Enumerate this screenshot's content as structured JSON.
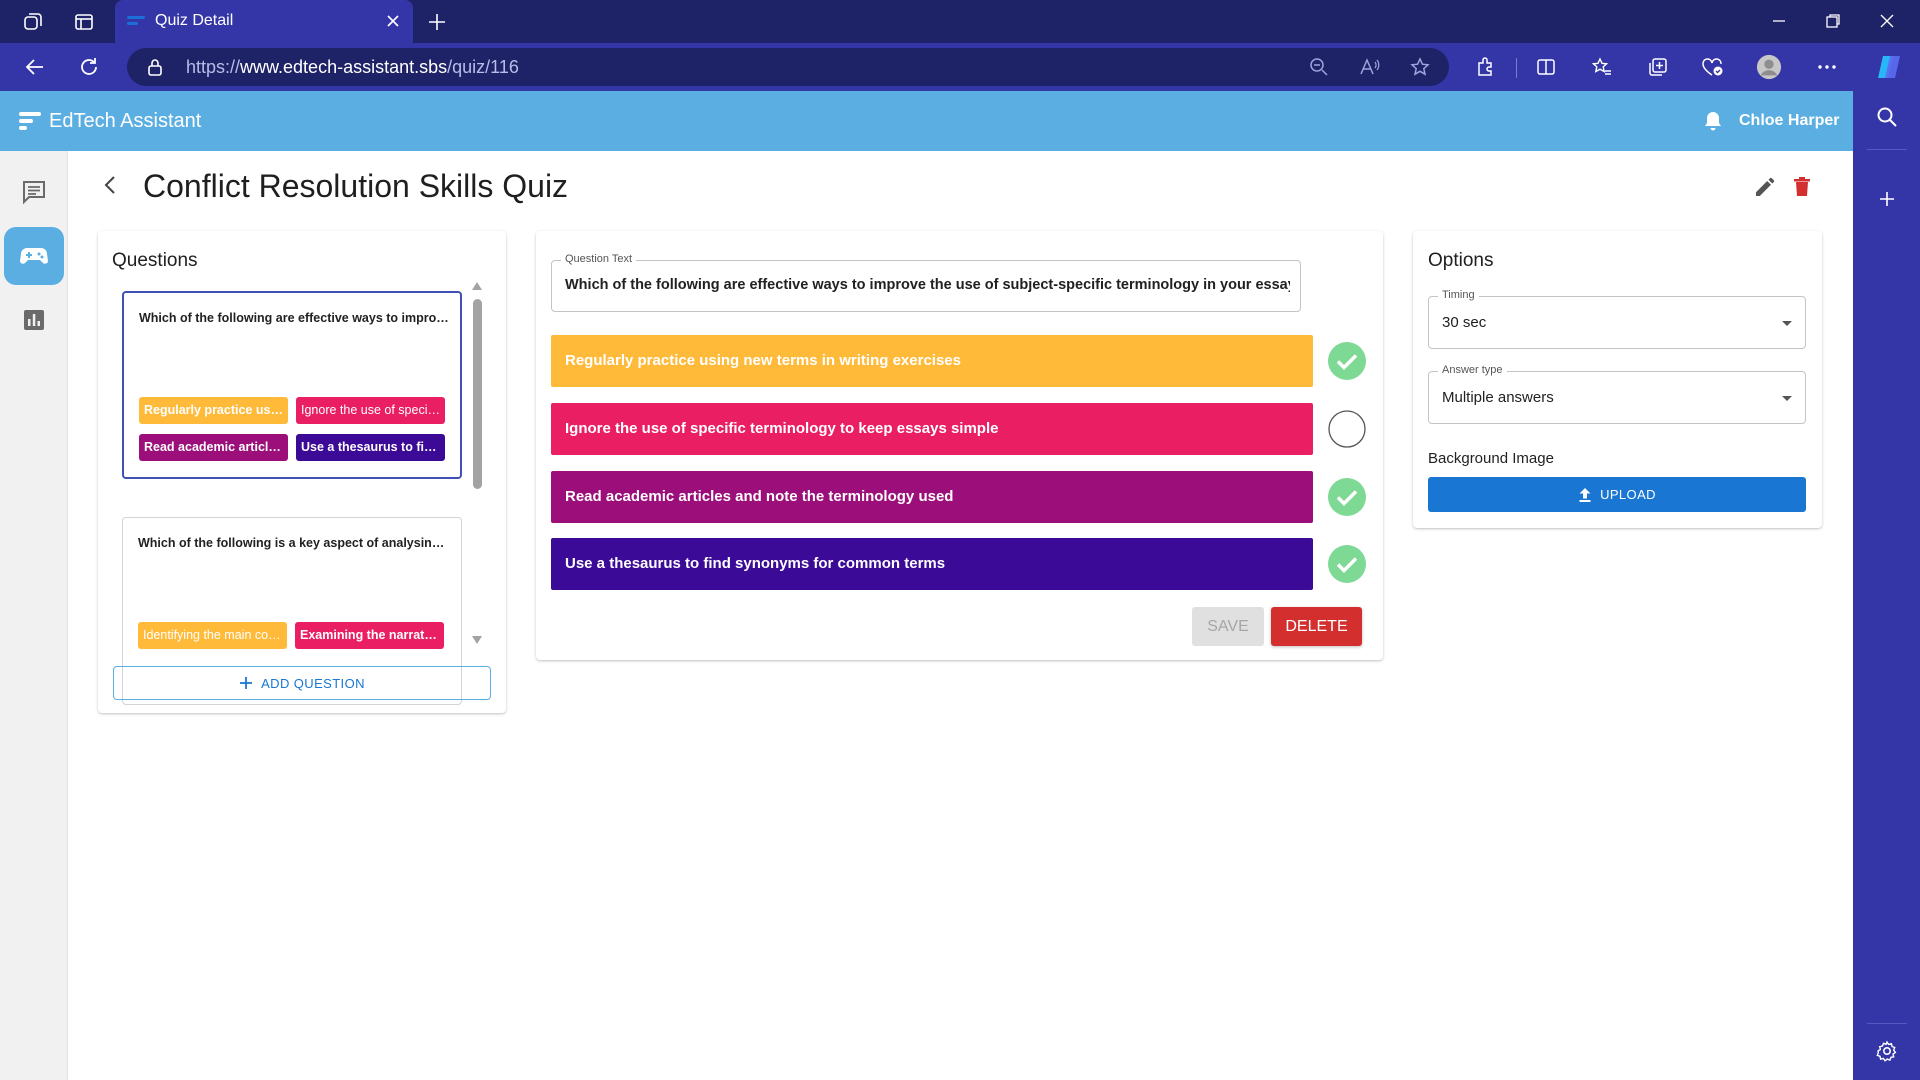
{
  "browser": {
    "tab_title": "Quiz Detail",
    "url_prefix": "https://",
    "url_domain": "www.edtech-assistant.sbs",
    "url_path": "/quiz/116"
  },
  "app": {
    "brand": "EdTech Assistant",
    "user_name": "Chloe Harper"
  },
  "page": {
    "title": "Conflict Resolution Skills Quiz"
  },
  "questions_panel": {
    "title": "Questions",
    "add_label": "ADD QUESTION",
    "questions": [
      {
        "text": "Which of the following are effective ways to improve the use of subject-specific terminology in your essays?",
        "answers": [
          "Regularly practice using new terms in writing exercises",
          "Ignore the use of specific terminology to keep essays simple",
          "Read academic articles and note the terminology used",
          "Use a thesaurus to find synonyms for common terms"
        ]
      },
      {
        "text": "Which of the following is a key aspect of analysing a text?",
        "answers": [
          "Identifying the main conflict",
          "Examining the narrative structure"
        ]
      }
    ]
  },
  "editor": {
    "question_label": "Question Text",
    "question_text": "Which of the following are effective ways to improve the use of subject-specific terminology in your essays?",
    "answers": [
      {
        "text": "Regularly practice using new terms in writing exercises",
        "correct": true
      },
      {
        "text": "Ignore the use of specific terminology to keep essays simple",
        "correct": false
      },
      {
        "text": "Read academic articles and note the terminology used",
        "correct": true
      },
      {
        "text": "Use a thesaurus to find synonyms for common terms",
        "correct": true
      }
    ],
    "save_label": "SAVE",
    "delete_label": "DELETE"
  },
  "options_panel": {
    "title": "Options",
    "timing_label": "Timing",
    "timing_value": "30 sec",
    "answer_type_label": "Answer type",
    "answer_type_value": "Multiple answers",
    "background_label": "Background Image",
    "upload_label": "UPLOAD"
  },
  "colors": {
    "answer_1": "#ffba39",
    "answer_2": "#e91e63",
    "answer_3": "#9c0f7b",
    "answer_4": "#3b0a96",
    "correct_check": "#7ed995",
    "header": "#5aaee1",
    "browser_dark": "#1e2266",
    "browser_mid": "#3436a8",
    "primary_button": "#1976d2",
    "delete_button": "#d32f2f"
  }
}
